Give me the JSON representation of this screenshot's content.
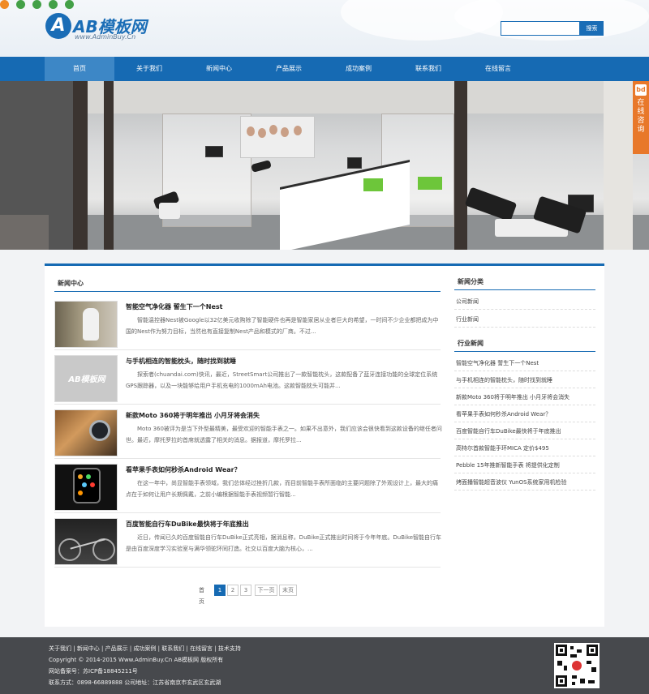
{
  "brand": {
    "mark_letter": "A",
    "name": "AB模板网",
    "site": "www.AdminBuy.Cn"
  },
  "search": {
    "placeholder": "",
    "button_label": "搜索"
  },
  "nav": {
    "items": [
      "首页",
      "关于我们",
      "新闻中心",
      "产品展示",
      "成功案例",
      "联系我们",
      "在线留言"
    ],
    "active_index": 0
  },
  "banner": {
    "slide_count": 5,
    "active_slide": 0,
    "side_tab": {
      "badge": "bd",
      "text": "在线咨询"
    }
  },
  "news_section": {
    "title": "新闻中心",
    "items": [
      {
        "title": "智能空气净化器 誓生下一个Nest",
        "summary": "智能温控器Nest被Google以32亿美元收购除了智能硬件也再是智能家居从业者巨大的希望，一时间不少企业都把成为中国的Nest作为努力目标，当然也有直接复制Nest产品和模式的厂商。不过...",
        "thumb": "air-purifier"
      },
      {
        "title": "与手机相连的智能枕头，随时找到就睡",
        "summary": "探索者(chuandai.com)快讯，最近，StreetSmart公司推出了一款智能枕头，这款配备了蓝牙连接功能的全球定位系统GPS跟踪器，以及一块能够给用户手机充电的1000mAh电池。这款智能枕头可能并...",
        "thumb": "placeholder-logo"
      },
      {
        "title": "新款Moto 360将于明年推出 小月牙将会消失",
        "summary": "Moto 360被评为是当下外型最精美，最受欢迎的智能手表之一。如果不出意外，我们应该会很快看到这款设备的继任者问世。最近，摩托罗拉的首席就透露了相关的消息。据报道，摩托罗拉...",
        "thumb": "moto-360"
      },
      {
        "title": "看苹果手表如何秒杀Android Wear？",
        "summary": "在这一年中，尚显智能手表领域，我们总体经过挫折几款，而目前智能手表所面临的主要问题除了外观设计上，最大的痛点在于如何让用户长期佩戴，之前小编根据智能手表视频暂行智能...",
        "thumb": "apple-watch"
      },
      {
        "title": "百度智能自行车DuBike最快将于年底推出",
        "summary": "近日，传闻已久的百度智能自行车DuBike正式亮相，据消息称，DuBike正式推出时间将于今年年底。DuBike智能自行车是由百度深度学习实验室与满华领驼环同打造。社交以百度大脑为核心，...",
        "thumb": "bicycle"
      }
    ]
  },
  "pagination": {
    "label": "首页",
    "pages": [
      "1",
      "2",
      "3"
    ],
    "active_page": "1",
    "next": "下一页",
    "last": "末页"
  },
  "sidebar": {
    "category_title": "新闻分类",
    "categories": [
      "公司新闻",
      "行业新闻"
    ],
    "industry_title": "行业新闻",
    "industry_items": [
      "智能空气净化器 誓生下一个Nest",
      "与手机相连的智能枕头，随时找到就睡",
      "新款Moto 360将于明年推出 小月牙将会消失",
      "看苹果手表如何秒杀Android Wear？",
      "百度智能自行车DuBike最快将于年底推出",
      "高特尔首款智能手环MICA 定价$495",
      "Pebble 15年推新智能手表 将提供化定制",
      "烤面播智能超音波仪 YunOS系统家用机检验"
    ]
  },
  "footer": {
    "links": [
      "关于我们",
      "新闻中心",
      "产品展示",
      "成功案例",
      "联系我们",
      "在线留言",
      "技术支持"
    ],
    "copyright": "Copyright © 2014-2015 Www.AdminBuy.Cn AB模板网 版权所有",
    "icp": "网站备案号：苏ICP备18845211号",
    "contact": "联系方式：0898-66889888 公司地址：江苏省南京市玄武区玄武湖"
  }
}
